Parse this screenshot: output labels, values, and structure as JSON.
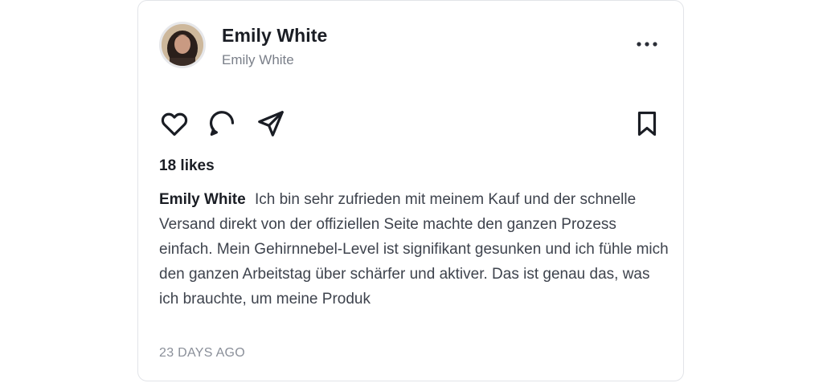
{
  "post": {
    "author_name": "Emily White",
    "author_handle": "Emily White",
    "likes_text": "18 likes",
    "caption_author": "Emily White",
    "caption_text": "Ich bin sehr zufrieden mit meinem Kauf und der schnelle Versand direkt von der offiziellen Seite machte den ganzen Prozess einfach. Mein Gehirnnebel-Level ist signifikant gesunken und ich fühle mich den ganzen Arbeitstag über schärfer und aktiver. Das ist genau das, was ich brauchte, um meine Produk",
    "time_ago": "23 DAYS AGO"
  },
  "icons": {
    "more": "more-horizontal-icon",
    "like": "heart-icon",
    "comment": "comment-icon",
    "share": "send-icon",
    "save": "bookmark-icon"
  },
  "colors": {
    "text_primary": "#1a1d24",
    "text_secondary": "#7a7f89",
    "border": "#e2e4e8"
  }
}
